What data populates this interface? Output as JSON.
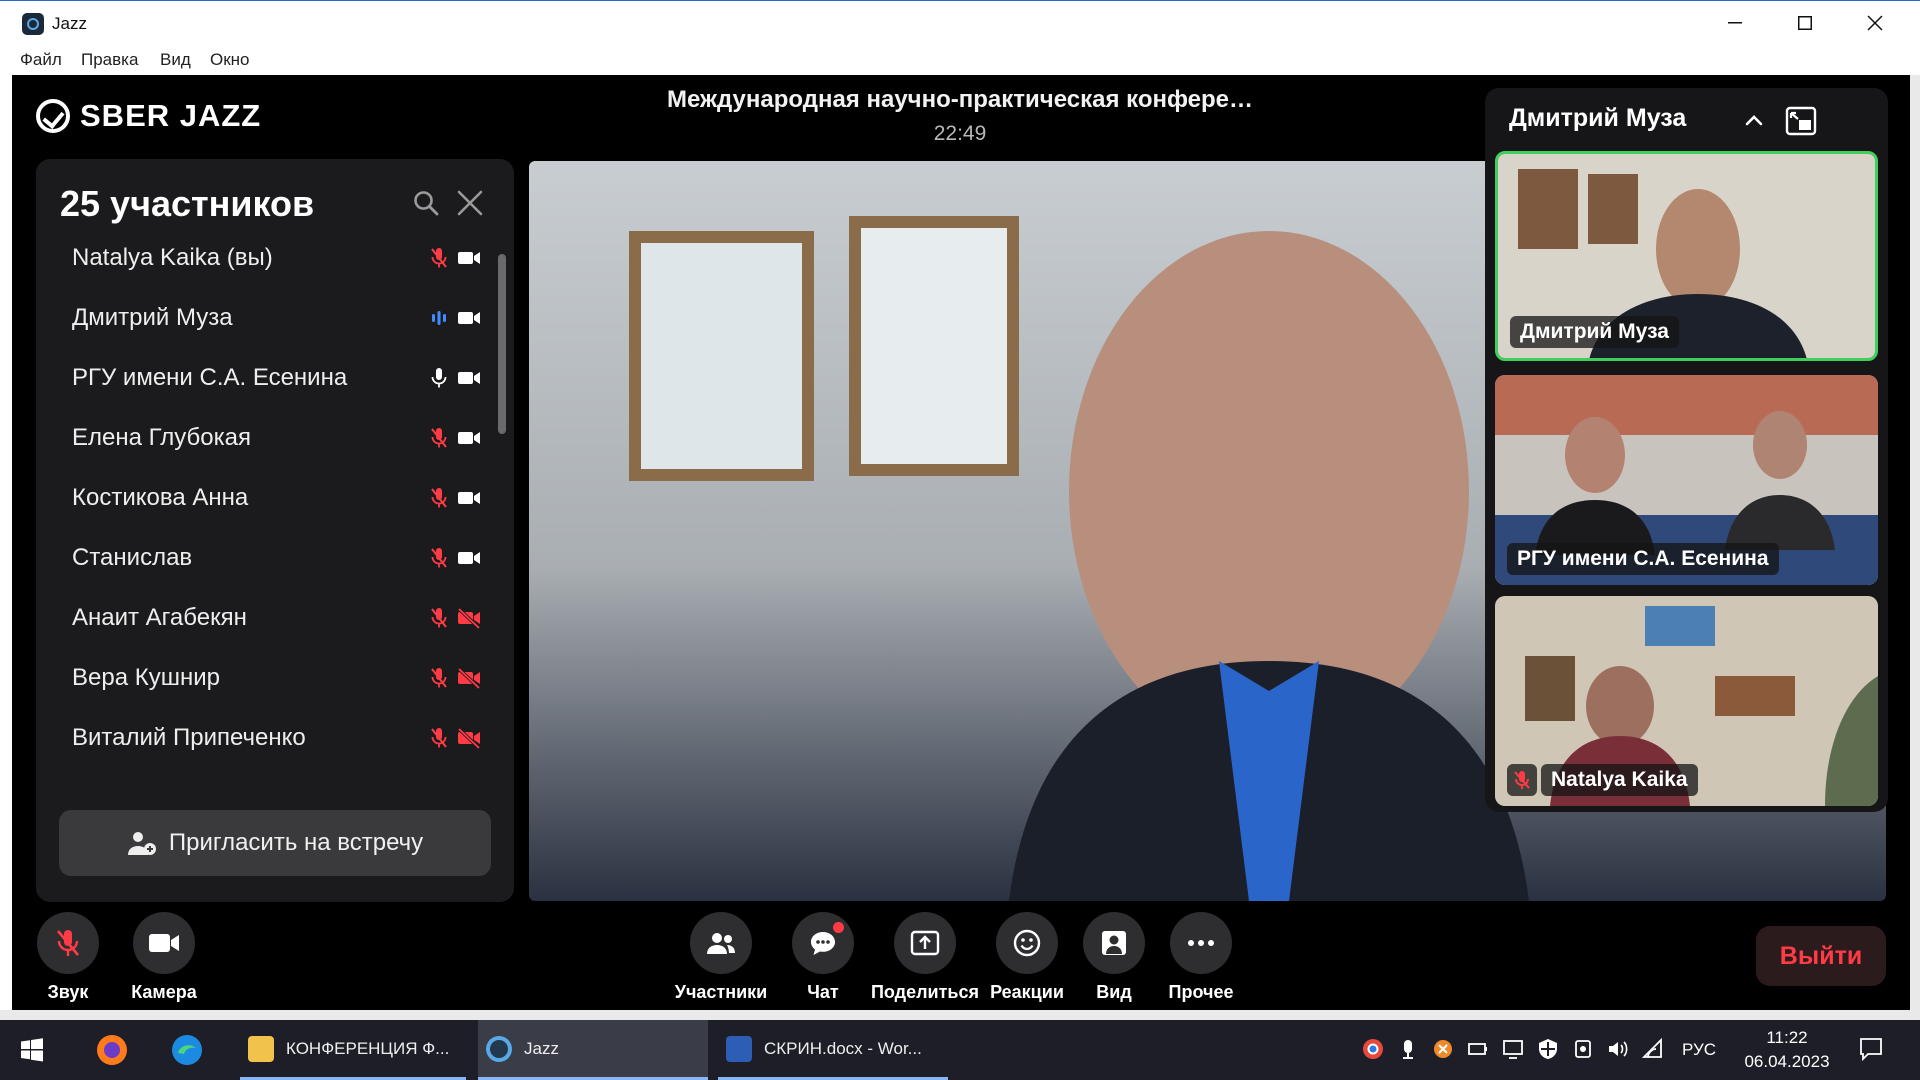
{
  "window": {
    "title": "Jazz",
    "minimize": "—",
    "maximize": "☐",
    "close": "✕"
  },
  "menu": [
    "Файл",
    "Правка",
    "Вид",
    "Окно"
  ],
  "brand": "SBER JAZZ",
  "meeting": {
    "title": "Международная научно-практическая конфере…",
    "timer": "22:49"
  },
  "participants": {
    "count_label": "25 участников",
    "list": [
      {
        "name": "Natalya Kaika (вы)",
        "mic": "muted",
        "camera": "on"
      },
      {
        "name": "Дмитрий Муза",
        "mic": "speaking",
        "camera": "on"
      },
      {
        "name": "РГУ имени С.А. Есенина",
        "mic": "on",
        "camera": "on"
      },
      {
        "name": "Елена Глубокая",
        "mic": "muted",
        "camera": "on"
      },
      {
        "name": "Костикова Анна",
        "mic": "muted",
        "camera": "on"
      },
      {
        "name": "Станислав",
        "mic": "muted",
        "camera": "on"
      },
      {
        "name": "Анаит Агабекян",
        "mic": "muted",
        "camera": "off"
      },
      {
        "name": "Вера Кушнир",
        "mic": "muted",
        "camera": "off"
      },
      {
        "name": "Виталий Припеченко",
        "mic": "muted",
        "camera": "off"
      }
    ],
    "invite_label": "Пригласить на встречу"
  },
  "right_panel": {
    "speaker_name": "Дмитрий Муза",
    "thumbnails": [
      {
        "label": "Дмитрий Муза",
        "active": true
      },
      {
        "label": "РГУ имени С.А. Есенина",
        "active": false
      },
      {
        "label": "Natalya Kaika",
        "active": false,
        "muted": true
      }
    ]
  },
  "controls": {
    "sound": "Звук",
    "camera": "Камера",
    "participants": "Участники",
    "chat": "Чат",
    "share": "Поделиться",
    "reactions": "Реакции",
    "view": "Вид",
    "more": "Прочее",
    "leave": "Выйти"
  },
  "taskbar": {
    "items": [
      {
        "label": "КОНФЕРЕНЦИЯ Ф...",
        "icon": "folder-icon"
      },
      {
        "label": "Jazz",
        "icon": "jazz-icon",
        "active": true
      },
      {
        "label": "СКРИН.docx - Wor...",
        "icon": "word-icon"
      }
    ],
    "language": "РУС",
    "time": "11:22",
    "date": "06.04.2023"
  },
  "colors": {
    "accent_red": "#ff3b46",
    "speaking_green": "#3fcf5a",
    "speaking_blue": "#3f8cff",
    "app_bg": "#000000",
    "panel_bg": "#1b1b1d"
  }
}
